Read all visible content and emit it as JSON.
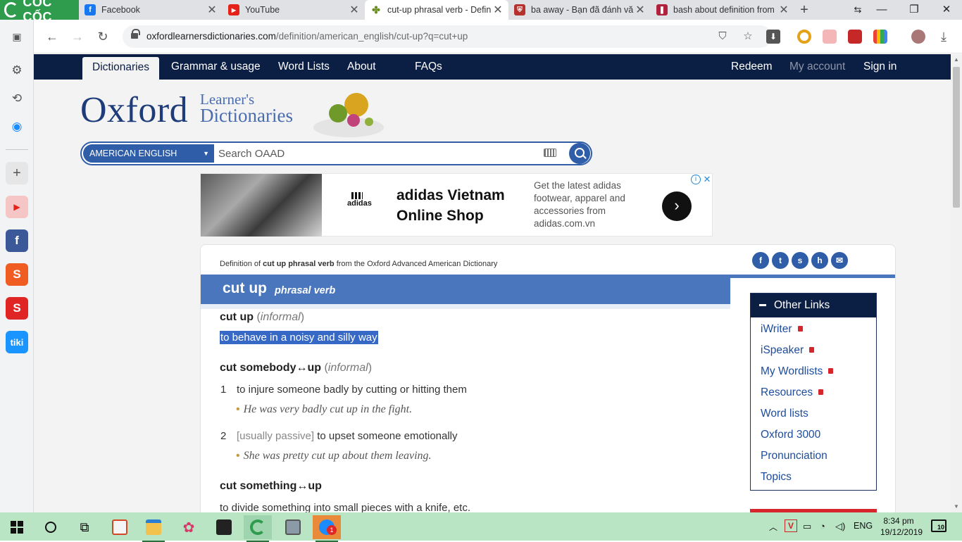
{
  "browser": {
    "brand_name": "CỐC CỐC",
    "tabs": [
      {
        "title": "Facebook",
        "icon": "facebook-icon",
        "color": "#1877f2",
        "glyph": "f"
      },
      {
        "title": "YouTube",
        "icon": "youtube-icon",
        "color": "#e62117",
        "glyph": "▶"
      },
      {
        "title": "cut-up phrasal verb - Definition",
        "icon": "oxford-icon",
        "color": "#6b8e23",
        "glyph": "✤"
      },
      {
        "title": "ba away - Bạn đã đánh văn",
        "icon": "cambridge-icon",
        "color": "#b5322e",
        "glyph": "⛨"
      },
      {
        "title": "bash about definition from",
        "icon": "collins-icon",
        "color": "#b0213b",
        "glyph": "❚"
      }
    ],
    "new_tab": "+",
    "window_controls": {
      "minimize": "—",
      "restore": "❐",
      "close": "✕",
      "extra": "⇆"
    },
    "url_host": "oxfordlearnersdictionaries.com",
    "url_path": "/definition/american_english/cut-up?q=cut+up",
    "side_rail": [
      "settings-icon",
      "history-icon",
      "messenger-icon",
      "add-icon",
      "youtube-icon",
      "facebook-icon",
      "shopee-icon",
      "sendo-icon",
      "tiki-icon"
    ]
  },
  "nav": {
    "items": [
      "Dictionaries",
      "Grammar & usage",
      "Word Lists",
      "About",
      "FAQs"
    ],
    "redeem": "Redeem",
    "my_account": "My account",
    "sign_in": "Sign in"
  },
  "logo": {
    "oxford": "Oxford",
    "learners": "Learner's",
    "dictionaries": "Dictionaries"
  },
  "search": {
    "dictionary": "AMERICAN ENGLISH",
    "placeholder": "Search OAAD"
  },
  "ad": {
    "brand": "adidas",
    "title": "adidas Vietnam Online Shop",
    "description": "Get the latest adidas footwear, apparel and accessories from adidas.com.vn"
  },
  "entry": {
    "source_prefix": "Definition of ",
    "source_word": "cut up phrasal verb",
    "source_suffix": " from the Oxford Advanced American Dictionary",
    "headword": "cut up",
    "pos": "phrasal verb",
    "share": [
      "f",
      "t",
      "s",
      "h",
      "✉"
    ],
    "pv1": {
      "phrase": "cut up",
      "label": "informal"
    },
    "pv1_def": "to behave in a noisy and silly way",
    "pv2": {
      "phrase": "cut somebody↔up",
      "label": "informal"
    },
    "pv2_senses": [
      {
        "num": "1",
        "grammar": "",
        "def": "to injure someone badly by cutting or hitting them",
        "example": "He was very badly cut up in the fight."
      },
      {
        "num": "2",
        "grammar": "[usually passive]",
        "def": "to upset someone emotionally",
        "example": "She was pretty cut up about them leaving."
      }
    ],
    "pv3": {
      "phrase": "cut something↔up"
    },
    "pv3_def": "to divide something into small pieces with a knife, etc."
  },
  "other_links": {
    "title": "Other Links",
    "items": [
      {
        "label": "iWriter",
        "locked": true
      },
      {
        "label": "iSpeaker",
        "locked": true
      },
      {
        "label": "My Wordlists",
        "locked": true
      },
      {
        "label": "Resources",
        "locked": true
      },
      {
        "label": "Word lists",
        "locked": false
      },
      {
        "label": "Oxford 3000",
        "locked": false
      },
      {
        "label": "Pronunciation",
        "locked": false
      },
      {
        "label": "Topics",
        "locked": false
      }
    ]
  },
  "taskbar": {
    "apps": [
      "start-icon",
      "search-icon",
      "task-view-icon",
      "office-icon",
      "file-explorer-icon",
      "paint-icon",
      "sticky-notes-icon",
      "coccoc-icon",
      "calculator-icon",
      "zalo-icon"
    ],
    "language": "ENG",
    "time": "8:34 pm",
    "date": "19/12/2019",
    "notifications": "10",
    "zalo_badge": "1"
  },
  "colors": {
    "nav_bg": "#0b1e44",
    "accent_blue": "#4a76bd",
    "link_blue": "#1d4c9c",
    "taskbar_bg": "#b9e5c4",
    "brand_green": "#2f9b4d"
  }
}
